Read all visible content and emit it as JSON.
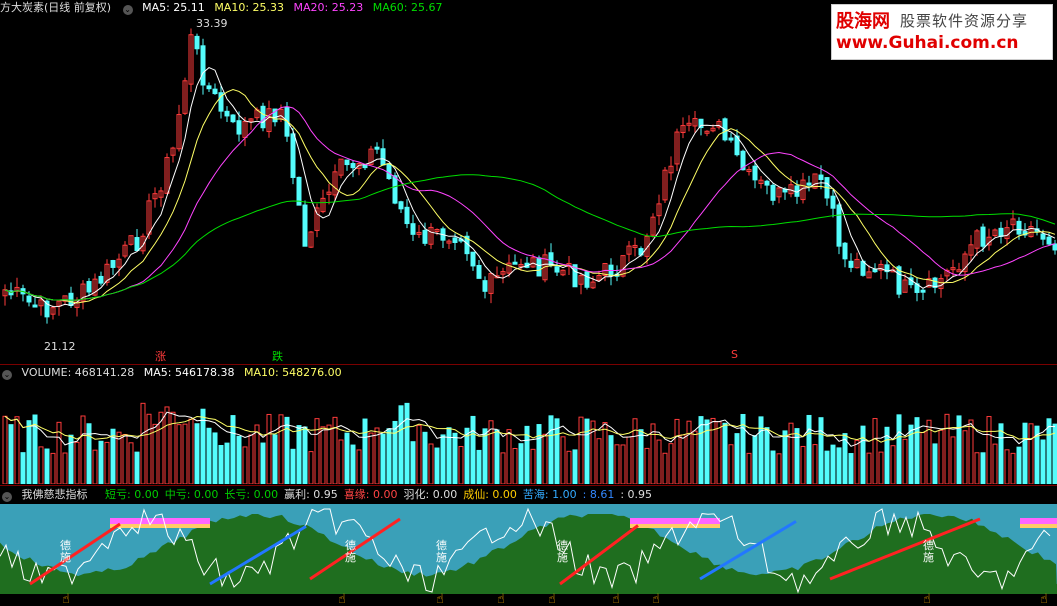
{
  "header": {
    "stock_name": "方大炭素(日线 前复权)",
    "ma5": "MA5: 25.11",
    "ma10": "MA10: 25.33",
    "ma20": "MA20: 25.23",
    "ma60": "MA60: 25.67",
    "high_label": "33.39",
    "low_label": "21.12",
    "signal_up": "涨",
    "signal_down": "跌",
    "signal_s": "S"
  },
  "volume": {
    "title": "VOLUME: 468141.28",
    "ma5": "MA5: 546178.38",
    "ma10": "MA10: 548276.00"
  },
  "indicator": {
    "name": "我佛慈悲指标",
    "items": [
      {
        "label": "短亏: 0.00",
        "color": "#00cc00"
      },
      {
        "label": "中亏: 0.00",
        "color": "#00cc00"
      },
      {
        "label": "长亏: 0.00",
        "color": "#00cc00"
      },
      {
        "label": "赢利: 0.95",
        "color": "#dddddd"
      },
      {
        "label": "喜缘: 0.00",
        "color": "#ff4444"
      },
      {
        "label": "羽化: 0.00",
        "color": "#dddddd"
      },
      {
        "label": "成仙: 0.00",
        "color": "#ffcc00"
      },
      {
        "label": "苦海: 1.00",
        "color": "#33aaff"
      },
      {
        "label": ": 8.61",
        "color": "#3388ff"
      },
      {
        "label": ": 0.95",
        "color": "#dddddd"
      }
    ],
    "text_marks": [
      "德",
      "施"
    ]
  },
  "logo": {
    "line1": "股海网",
    "line1b": "股票软件资源分享",
    "line2": "www.Guhai.com.cn"
  },
  "colors": {
    "up": "#ff3b3b",
    "down": "#54fcfc",
    "ma5": "#ffffff",
    "ma10": "#ffff66",
    "ma20": "#ff44ff",
    "ma60": "#00dd00"
  }
}
